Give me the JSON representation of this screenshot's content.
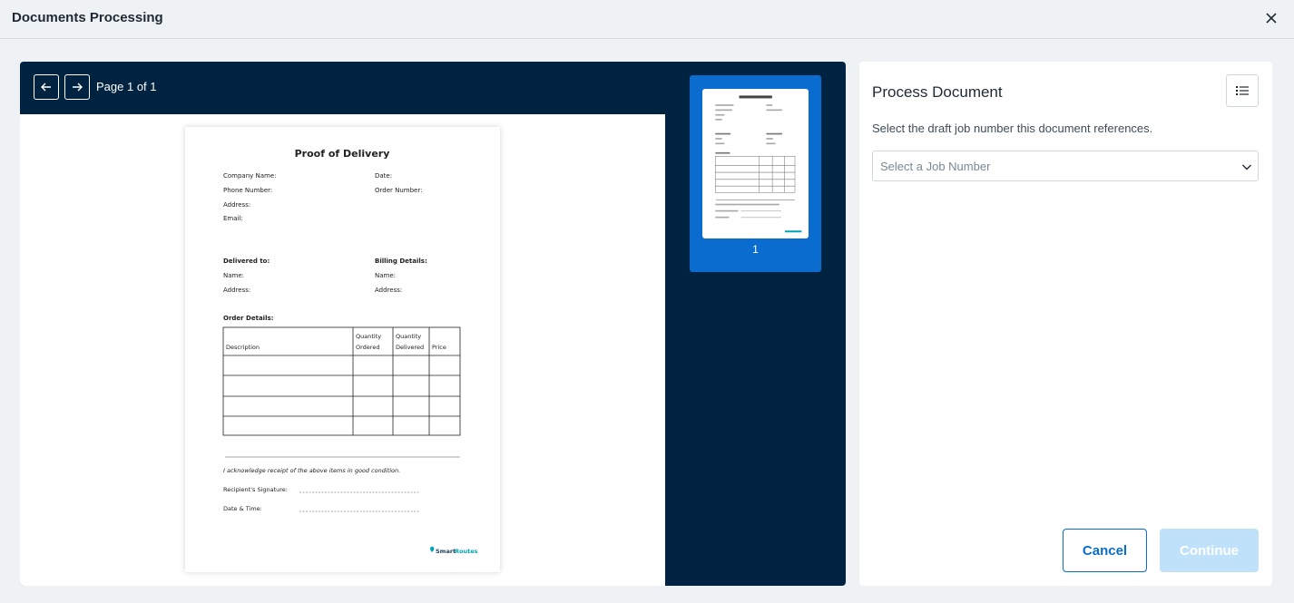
{
  "window": {
    "title": "Documents Processing",
    "close_icon": "close-icon"
  },
  "viewer": {
    "page_info": "Page 1 of 1",
    "thumbnail_number": "1",
    "document": {
      "title": "Proof of Delivery",
      "company_name": "Company Name:",
      "date": "Date:",
      "phone": "Phone Number:",
      "order_number": "Order Number:",
      "address": "Address:",
      "email": "Email:",
      "delivered_to": "Delivered to:",
      "billing_details": "Billing Details:",
      "name": "Name:",
      "order_details": "Order Details:",
      "col_description": "Description",
      "col_qty_ordered_1": "Quantity",
      "col_qty_ordered_2": "Ordered",
      "col_qty_delivered_1": "Quantity",
      "col_qty_delivered_2": "Delivered",
      "col_price": "Price",
      "acknowledge": "I acknowledge receipt of the above items in good condition.",
      "signature": "Recipient's Signature:",
      "date_time": "Date & Time:",
      "brand_smart": "Smart",
      "brand_routes": "Routes"
    }
  },
  "panel": {
    "heading": "Process Document",
    "description": "Select the draft job number this document references.",
    "select_placeholder": "Select a Job Number",
    "cancel_label": "Cancel",
    "continue_label": "Continue"
  },
  "colors": {
    "viewer_bg": "#002341",
    "accent": "#0a6ccf",
    "continue_disabled": "#bfe2fa"
  }
}
